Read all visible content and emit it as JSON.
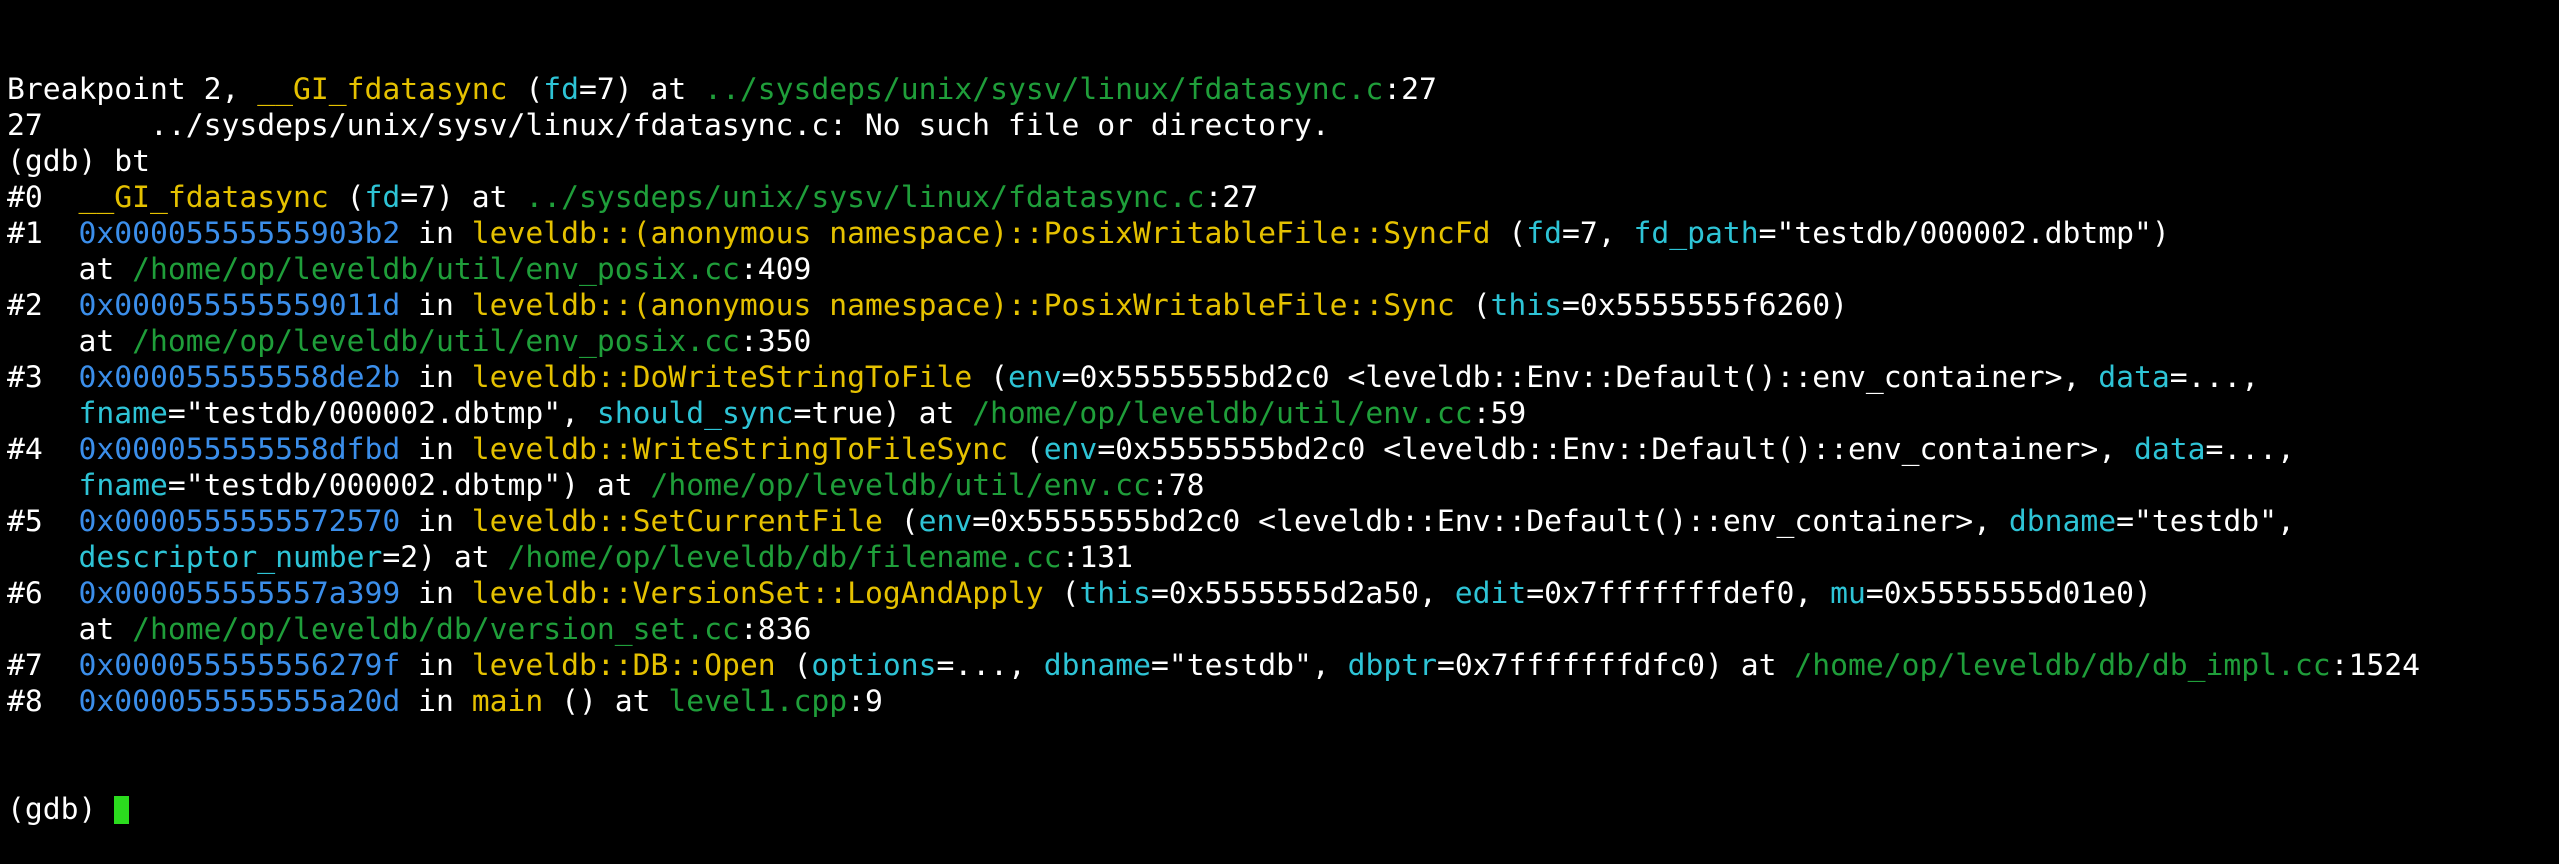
{
  "terminal": {
    "colors": {
      "background": "#000000",
      "text": "#ffffff",
      "address": "#3b8eea",
      "function": "#e5c100",
      "parameter": "#2ec4d6",
      "path": "#1f9e3a",
      "cursor": "#2bdc1e"
    },
    "lines": [
      {
        "segments": [
          {
            "t": "Breakpoint 2, ",
            "c": "white"
          },
          {
            "t": "__GI_fdatasync",
            "c": "func"
          },
          {
            "t": " (",
            "c": "white"
          },
          {
            "t": "fd",
            "c": "param"
          },
          {
            "t": "=7) at ",
            "c": "white"
          },
          {
            "t": "../sysdeps/unix/sysv/linux/fdatasync.c",
            "c": "path"
          },
          {
            "t": ":27",
            "c": "white"
          }
        ]
      },
      {
        "segments": [
          {
            "t": "27      ../sysdeps/unix/sysv/linux/fdatasync.c: No such file or directory.",
            "c": "white"
          }
        ]
      },
      {
        "segments": [
          {
            "t": "(gdb) bt",
            "c": "white"
          }
        ]
      },
      {
        "segments": [
          {
            "t": "#0  ",
            "c": "white"
          },
          {
            "t": "__GI_fdatasync",
            "c": "func"
          },
          {
            "t": " (",
            "c": "white"
          },
          {
            "t": "fd",
            "c": "param"
          },
          {
            "t": "=7) at ",
            "c": "white"
          },
          {
            "t": "../sysdeps/unix/sysv/linux/fdatasync.c",
            "c": "path"
          },
          {
            "t": ":27",
            "c": "white"
          }
        ]
      },
      {
        "segments": [
          {
            "t": "#1  ",
            "c": "white"
          },
          {
            "t": "0x00005555555903b2",
            "c": "addr"
          },
          {
            "t": " in ",
            "c": "white"
          },
          {
            "t": "leveldb::(anonymous namespace)::PosixWritableFile::SyncFd",
            "c": "func"
          },
          {
            "t": " (",
            "c": "white"
          },
          {
            "t": "fd",
            "c": "param"
          },
          {
            "t": "=7, ",
            "c": "white"
          },
          {
            "t": "fd_path",
            "c": "param"
          },
          {
            "t": "=\"testdb/000002.dbtmp\")",
            "c": "white"
          }
        ]
      },
      {
        "segments": [
          {
            "t": "    at ",
            "c": "white"
          },
          {
            "t": "/home/op/leveldb/util/env_posix.cc",
            "c": "path"
          },
          {
            "t": ":409",
            "c": "white"
          }
        ]
      },
      {
        "segments": [
          {
            "t": "#2  ",
            "c": "white"
          },
          {
            "t": "0x000055555559011d",
            "c": "addr"
          },
          {
            "t": " in ",
            "c": "white"
          },
          {
            "t": "leveldb::(anonymous namespace)::PosixWritableFile::Sync",
            "c": "func"
          },
          {
            "t": " (",
            "c": "white"
          },
          {
            "t": "this",
            "c": "param"
          },
          {
            "t": "=0x5555555f6260)",
            "c": "white"
          }
        ]
      },
      {
        "segments": [
          {
            "t": "    at ",
            "c": "white"
          },
          {
            "t": "/home/op/leveldb/util/env_posix.cc",
            "c": "path"
          },
          {
            "t": ":350",
            "c": "white"
          }
        ]
      },
      {
        "segments": [
          {
            "t": "#3  ",
            "c": "white"
          },
          {
            "t": "0x000055555558de2b",
            "c": "addr"
          },
          {
            "t": " in ",
            "c": "white"
          },
          {
            "t": "leveldb::DoWriteStringToFile",
            "c": "func"
          },
          {
            "t": " (",
            "c": "white"
          },
          {
            "t": "env",
            "c": "param"
          },
          {
            "t": "=0x5555555bd2c0 <leveldb::Env::Default()::env_container>, ",
            "c": "white"
          },
          {
            "t": "data",
            "c": "param"
          },
          {
            "t": "=...,",
            "c": "white"
          }
        ]
      },
      {
        "segments": [
          {
            "t": "    ",
            "c": "white"
          },
          {
            "t": "fname",
            "c": "param"
          },
          {
            "t": "=\"testdb/000002.dbtmp\", ",
            "c": "white"
          },
          {
            "t": "should_sync",
            "c": "param"
          },
          {
            "t": "=true) at ",
            "c": "white"
          },
          {
            "t": "/home/op/leveldb/util/env.cc",
            "c": "path"
          },
          {
            "t": ":59",
            "c": "white"
          }
        ]
      },
      {
        "segments": [
          {
            "t": "#4  ",
            "c": "white"
          },
          {
            "t": "0x000055555558dfbd",
            "c": "addr"
          },
          {
            "t": " in ",
            "c": "white"
          },
          {
            "t": "leveldb::WriteStringToFileSync",
            "c": "func"
          },
          {
            "t": " (",
            "c": "white"
          },
          {
            "t": "env",
            "c": "param"
          },
          {
            "t": "=0x5555555bd2c0 <leveldb::Env::Default()::env_container>, ",
            "c": "white"
          },
          {
            "t": "data",
            "c": "param"
          },
          {
            "t": "=...,",
            "c": "white"
          }
        ]
      },
      {
        "segments": [
          {
            "t": "    ",
            "c": "white"
          },
          {
            "t": "fname",
            "c": "param"
          },
          {
            "t": "=\"testdb/000002.dbtmp\") at ",
            "c": "white"
          },
          {
            "t": "/home/op/leveldb/util/env.cc",
            "c": "path"
          },
          {
            "t": ":78",
            "c": "white"
          }
        ]
      },
      {
        "segments": [
          {
            "t": "#5  ",
            "c": "white"
          },
          {
            "t": "0x0000555555572570",
            "c": "addr"
          },
          {
            "t": " in ",
            "c": "white"
          },
          {
            "t": "leveldb::SetCurrentFile",
            "c": "func"
          },
          {
            "t": " (",
            "c": "white"
          },
          {
            "t": "env",
            "c": "param"
          },
          {
            "t": "=0x5555555bd2c0 <leveldb::Env::Default()::env_container>, ",
            "c": "white"
          },
          {
            "t": "dbname",
            "c": "param"
          },
          {
            "t": "=\"testdb\",",
            "c": "white"
          }
        ]
      },
      {
        "segments": [
          {
            "t": "    ",
            "c": "white"
          },
          {
            "t": "descriptor_number",
            "c": "param"
          },
          {
            "t": "=2) at ",
            "c": "white"
          },
          {
            "t": "/home/op/leveldb/db/filename.cc",
            "c": "path"
          },
          {
            "t": ":131",
            "c": "white"
          }
        ]
      },
      {
        "segments": [
          {
            "t": "#6  ",
            "c": "white"
          },
          {
            "t": "0x000055555557a399",
            "c": "addr"
          },
          {
            "t": " in ",
            "c": "white"
          },
          {
            "t": "leveldb::VersionSet::LogAndApply",
            "c": "func"
          },
          {
            "t": " (",
            "c": "white"
          },
          {
            "t": "this",
            "c": "param"
          },
          {
            "t": "=0x5555555d2a50, ",
            "c": "white"
          },
          {
            "t": "edit",
            "c": "param"
          },
          {
            "t": "=0x7fffffffdef0, ",
            "c": "white"
          },
          {
            "t": "mu",
            "c": "param"
          },
          {
            "t": "=0x5555555d01e0)",
            "c": "white"
          }
        ]
      },
      {
        "segments": [
          {
            "t": "    at ",
            "c": "white"
          },
          {
            "t": "/home/op/leveldb/db/version_set.cc",
            "c": "path"
          },
          {
            "t": ":836",
            "c": "white"
          }
        ]
      },
      {
        "segments": [
          {
            "t": "#7  ",
            "c": "white"
          },
          {
            "t": "0x000055555556279f",
            "c": "addr"
          },
          {
            "t": " in ",
            "c": "white"
          },
          {
            "t": "leveldb::DB::Open",
            "c": "func"
          },
          {
            "t": " (",
            "c": "white"
          },
          {
            "t": "options",
            "c": "param"
          },
          {
            "t": "=..., ",
            "c": "white"
          },
          {
            "t": "dbname",
            "c": "param"
          },
          {
            "t": "=\"testdb\", ",
            "c": "white"
          },
          {
            "t": "dbptr",
            "c": "param"
          },
          {
            "t": "=0x7fffffffdfc0) at ",
            "c": "white"
          },
          {
            "t": "/home/op/leveldb/db/db_impl.cc",
            "c": "path"
          },
          {
            "t": ":1524",
            "c": "white"
          }
        ]
      },
      {
        "segments": [
          {
            "t": "#8  ",
            "c": "white"
          },
          {
            "t": "0x000055555555a20d",
            "c": "addr"
          },
          {
            "t": " in ",
            "c": "white"
          },
          {
            "t": "main",
            "c": "func"
          },
          {
            "t": " () at ",
            "c": "white"
          },
          {
            "t": "level1.cpp",
            "c": "path"
          },
          {
            "t": ":9",
            "c": "white"
          }
        ]
      }
    ],
    "prompt": "(gdb) "
  }
}
